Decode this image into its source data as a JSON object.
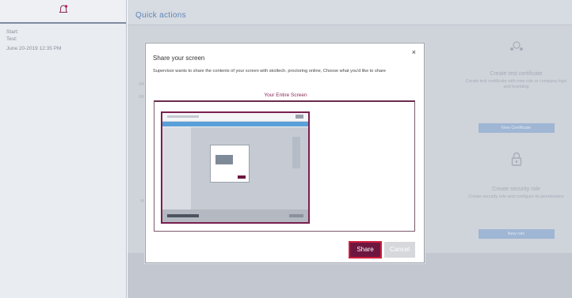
{
  "sidebar": {
    "icon": "bell-icon",
    "start_label": "Start:",
    "test_label": "Test:",
    "datetime": "June 20-2019 12:35 PM"
  },
  "main": {
    "title": "Quick actions",
    "cards_right": [
      {
        "icon": "certificate-icon",
        "title": "Create test certificate",
        "desc": "Create test certificate with new role or company logo and branding",
        "button": "New Certificate"
      },
      {
        "icon": "lock-icon",
        "title": "Create security role",
        "desc": "Create security role and configure its permissions",
        "button": "New role"
      }
    ]
  },
  "modal": {
    "title": "Share your screen",
    "close": "×",
    "description": "Supervisor wants to share the contents of your screen with skoltech. proctoring online, Choose what you'd like to share",
    "tab_label": "Your Entire Screen",
    "share_label": "Share",
    "cancel_label": "Cancel"
  },
  "colors": {
    "accent": "#6d1740",
    "share_border": "#d21d3c",
    "tab_text": "#8b2757"
  }
}
